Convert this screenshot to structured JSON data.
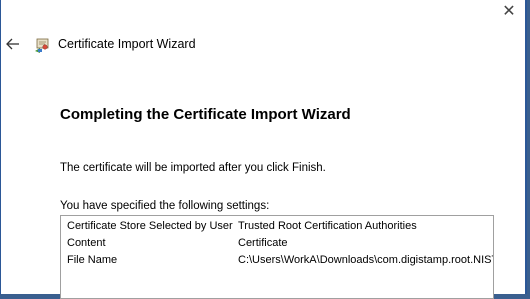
{
  "window": {
    "close_glyph": "✕",
    "back_icon": "back-arrow-icon",
    "wizard_icon": "certificate-wizard-icon",
    "title": "Certificate Import Wizard"
  },
  "main": {
    "heading": "Completing the Certificate Import Wizard",
    "info": "The certificate will be imported after you click Finish.",
    "settings_label": "You have specified the following settings:",
    "settings": [
      {
        "key": "Certificate Store Selected by User",
        "value": "Trusted Root Certification Authorities"
      },
      {
        "key": "Content",
        "value": "Certificate"
      },
      {
        "key": "File Name",
        "value": "C:\\Users\\WorkA\\Downloads\\com.digistamp.root.NIST"
      }
    ]
  },
  "colors": {
    "frame": "#2b5797",
    "background": "#ffffff",
    "listbox_border": "#a0a0a0"
  }
}
